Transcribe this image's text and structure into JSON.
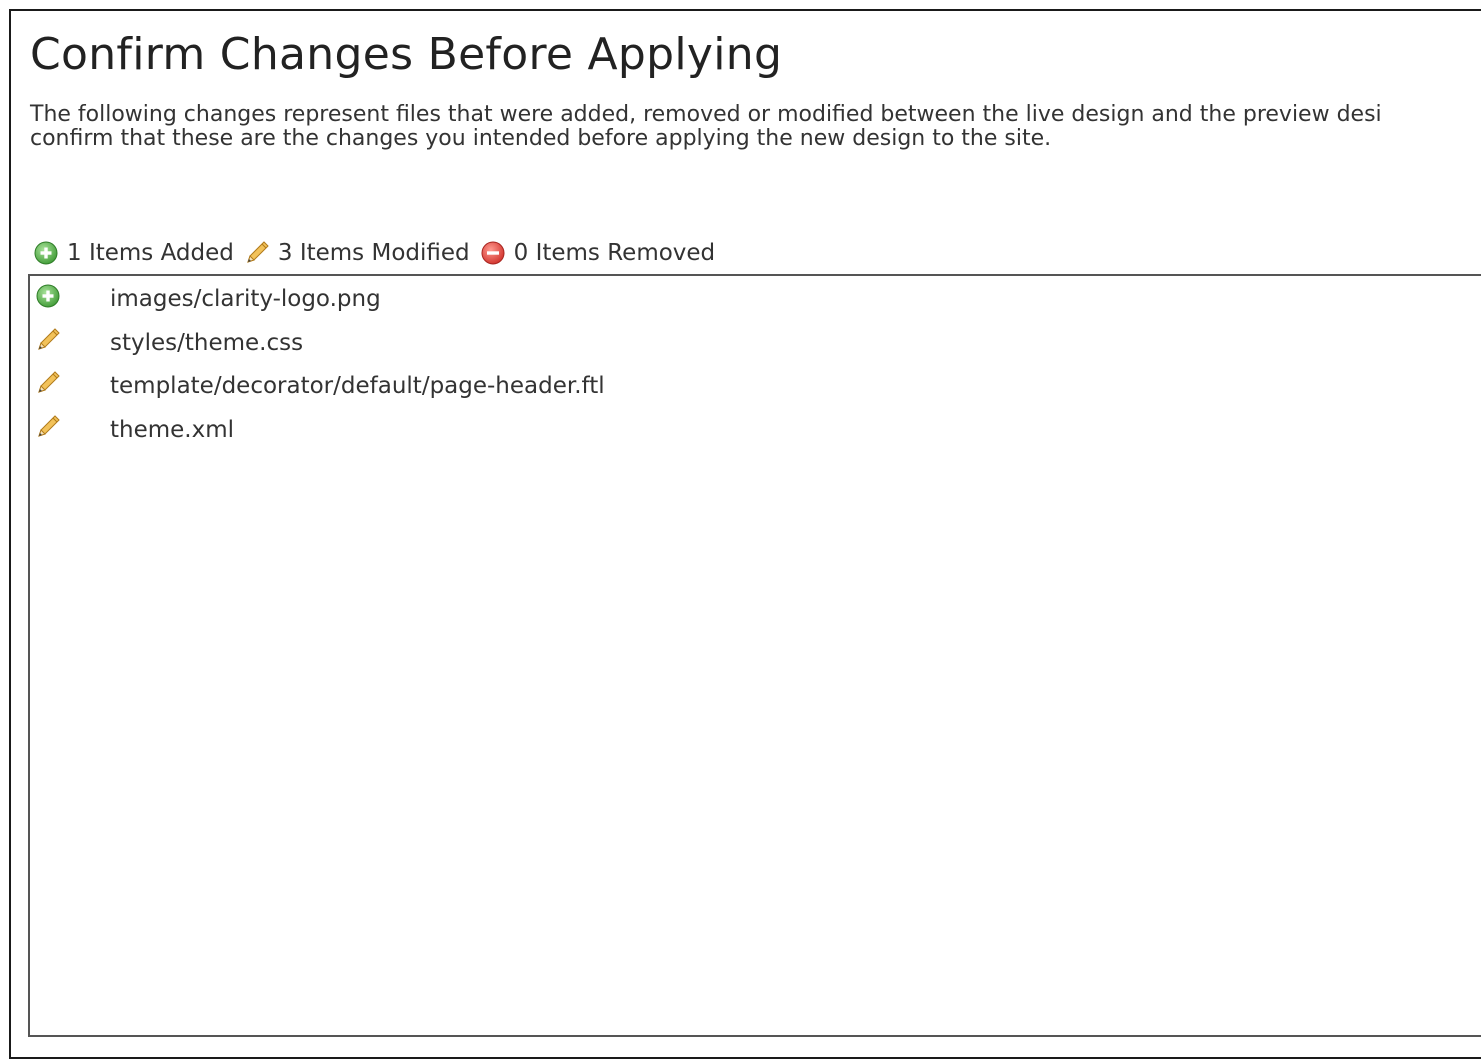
{
  "page": {
    "title": "Confirm Changes Before Applying",
    "description_line1": "The following changes represent files that were added, removed or modified between the live design and the preview desi",
    "description_line2": "confirm that these are the changes you intended before applying the new design to the site."
  },
  "summary": {
    "added": {
      "label": "1 Items Added",
      "icon": "plus-circle-icon"
    },
    "modified": {
      "label": "3 Items Modified",
      "icon": "pencil-icon"
    },
    "removed": {
      "label": "0 Items Removed",
      "icon": "minus-circle-icon"
    }
  },
  "files": [
    {
      "path": "images/clarity-logo.png",
      "change": "added",
      "icon": "plus-circle-icon"
    },
    {
      "path": "styles/theme.css",
      "change": "modified",
      "icon": "pencil-icon"
    },
    {
      "path": "template/decorator/default/page-header.ftl",
      "change": "modified",
      "icon": "pencil-icon"
    },
    {
      "path": "theme.xml",
      "change": "modified",
      "icon": "pencil-icon"
    }
  ],
  "colors": {
    "added": "#4caf50",
    "modified": "#e8a33a",
    "removed": "#e0403a",
    "text": "#333333"
  }
}
